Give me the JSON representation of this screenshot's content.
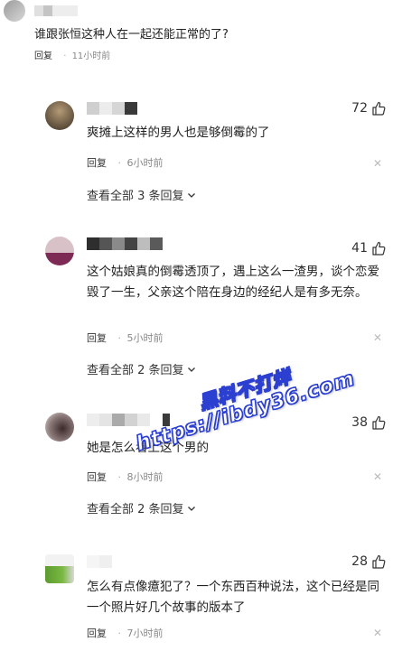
{
  "parent_comment": {
    "text": "谁跟张恒这种人在一起还能正常的了?",
    "reply_label": "回复",
    "time": "11小时前"
  },
  "replies": [
    {
      "likes": "72",
      "text": "爽摊上这样的男人也是够倒霉的了",
      "reply_label": "回复",
      "time": "6小时前",
      "view_more": "查看全部 3 条回复"
    },
    {
      "likes": "41",
      "text": "这个姑娘真的倒霉透顶了，遇上这么一渣男，谈个恋爱毁了一生，父亲这个陪在身边的经纪人是有多无奈。",
      "reply_label": "回复",
      "time": "5小时前",
      "view_more": "查看全部 2 条回复"
    },
    {
      "likes": "38",
      "text": "她是怎么看上这个男的",
      "reply_label": "回复",
      "time": "8小时前",
      "view_more": "查看全部 2 条回复"
    },
    {
      "likes": "28",
      "text": "怎么有点像癔犯了？一个东西百种说法，这个已经是同一个照片好几个故事的版本了",
      "reply_label": "回复",
      "time": "7小时前",
      "view_more": ""
    }
  ],
  "icons": {
    "like": "thumbs-up-icon",
    "close": "close-icon",
    "expand": "chevron-down-icon"
  },
  "watermark": {
    "line1": "黑料不打烊",
    "line2": "https://ibdy36.com"
  },
  "colors": {
    "watermark_stroke": "#2b3fd1",
    "meta_gray": "#888888"
  }
}
